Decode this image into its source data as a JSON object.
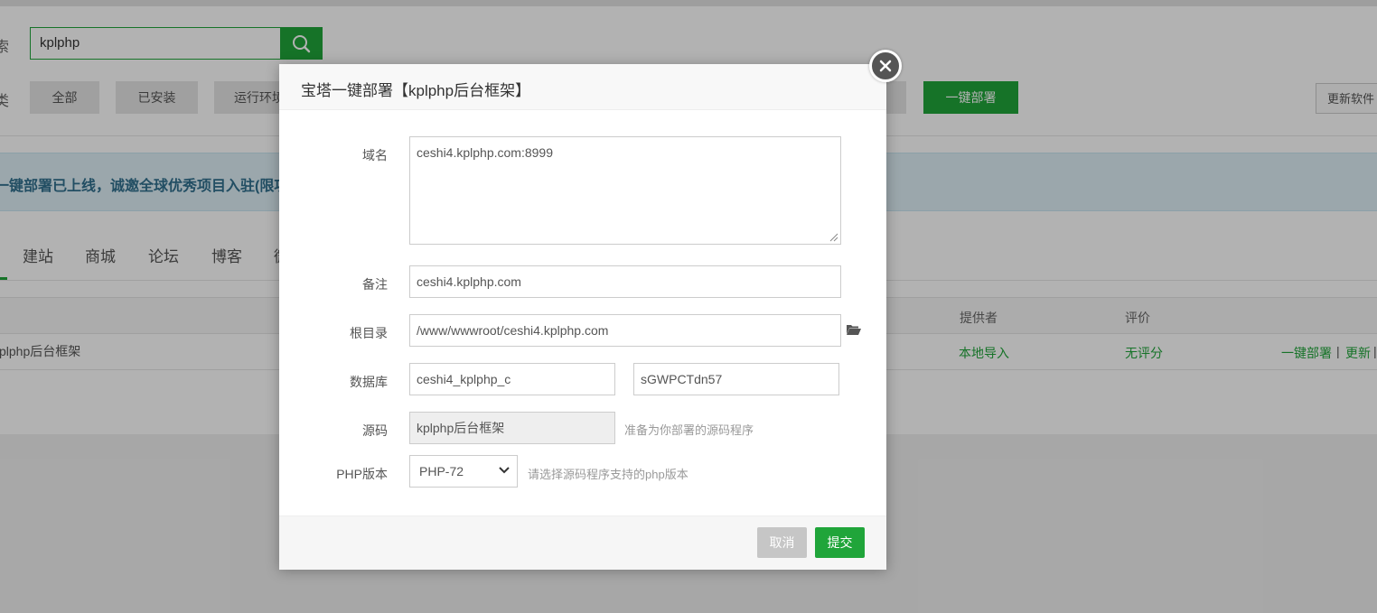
{
  "background": {
    "search": {
      "label": "索",
      "value": "kplphp"
    },
    "type_label": "类",
    "filters": [
      "全部",
      "已安装",
      "运行环境"
    ],
    "deploy_button": "一键部署",
    "update_button": "更新软件",
    "notice": "一键部署已上线，诚邀全球优秀项目入驻(限项目",
    "categories": [
      "建站",
      "商城",
      "论坛",
      "博客",
      "微"
    ],
    "table": {
      "headers": {
        "provider": "提供者",
        "rating": "评价"
      },
      "row": {
        "name": "kplphp后台框架",
        "provider": "本地导入",
        "rating": "无评分",
        "actions": {
          "deploy": "一键部署",
          "sep": "|",
          "update": "更新",
          "sep2": "|"
        }
      }
    }
  },
  "modal": {
    "title": "宝塔一键部署【kplphp后台框架】",
    "fields": {
      "domain": {
        "label": "域名",
        "value": "ceshi4.kplphp.com:8999"
      },
      "remark": {
        "label": "备注",
        "value": "ceshi4.kplphp.com"
      },
      "root": {
        "label": "根目录",
        "value": "/www/wwwroot/ceshi4.kplphp.com"
      },
      "database": {
        "label": "数据库",
        "name": "ceshi4_kplphp_c",
        "password": "sGWPCTdn57"
      },
      "source": {
        "label": "源码",
        "value": "kplphp后台框架",
        "hint": "准备为你部署的源码程序"
      },
      "php": {
        "label": "PHP版本",
        "value": "PHP-72",
        "hint": "请选择源码程序支持的php版本"
      }
    },
    "buttons": {
      "cancel": "取消",
      "submit": "提交"
    }
  },
  "colors": {
    "accent": "#20a53a",
    "notice_text": "#31708f"
  }
}
